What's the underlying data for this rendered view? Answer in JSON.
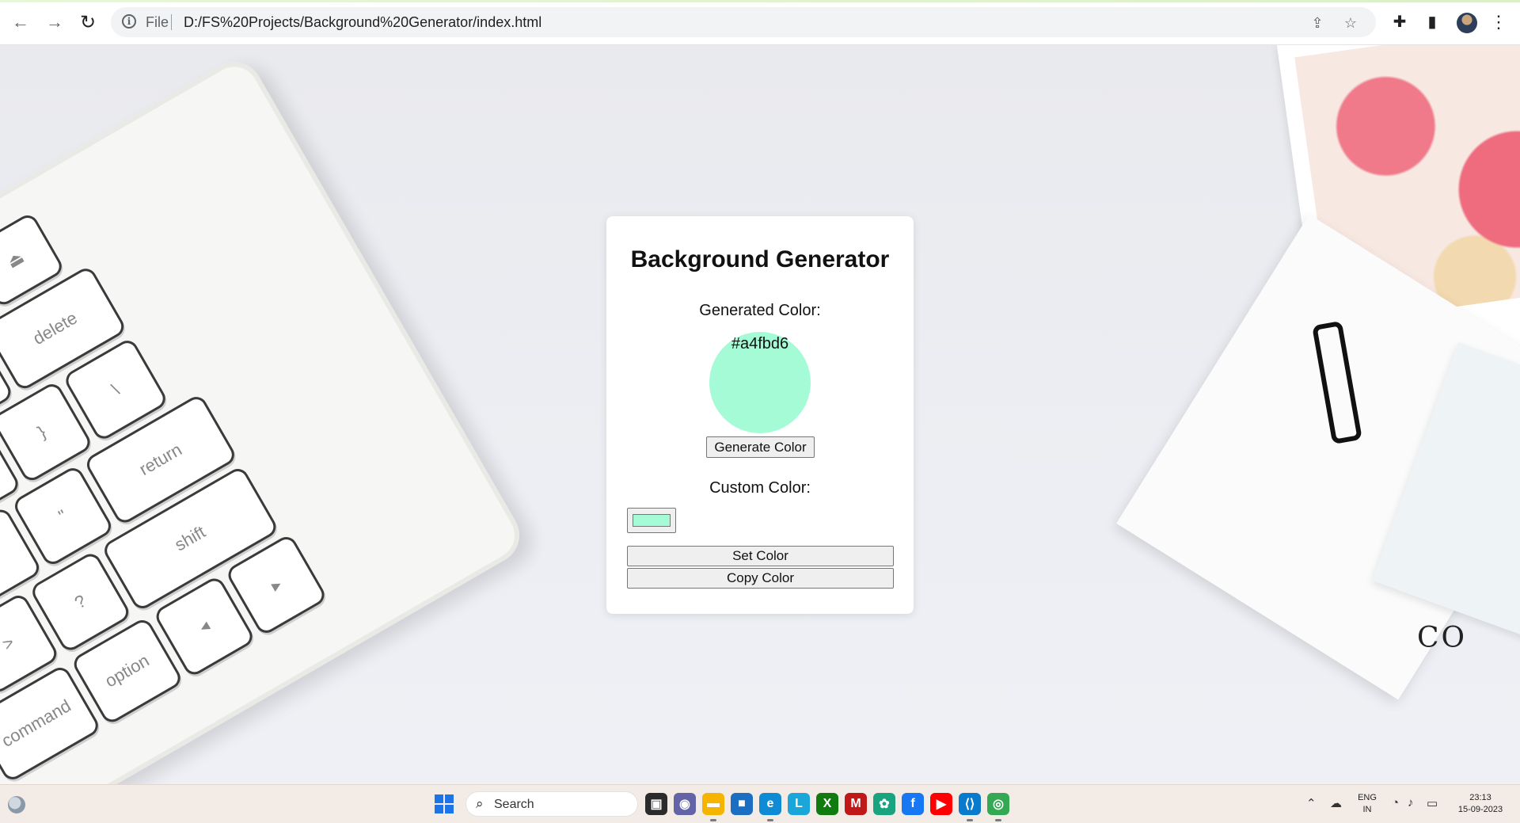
{
  "browser": {
    "nav": {
      "back_icon": "back-arrow-icon",
      "forward_icon": "forward-arrow-icon",
      "reload_icon": "reload-icon"
    },
    "omnibox": {
      "scheme_label": "File",
      "url": "D:/FS%20Projects/Background%20Generator/index.html"
    }
  },
  "app": {
    "title": "Background Generator",
    "generated_label": "Generated Color:",
    "generated_hex": "#a4fbd6",
    "generated_color": "#a4fbd6",
    "generate_button": "Generate Color",
    "custom_label": "Custom Color:",
    "custom_color": "#a4fbd6",
    "set_button": "Set Color",
    "copy_button": "Copy Color"
  },
  "taskbar": {
    "search_placeholder": "Search",
    "apps": [
      {
        "name": "task-view",
        "color": "#2b2b2b",
        "glyph": "▣"
      },
      {
        "name": "teams-chat",
        "color": "#6264a7",
        "glyph": "◉"
      },
      {
        "name": "file-explorer",
        "color": "#f4b400",
        "glyph": "▬"
      },
      {
        "name": "microsoft-store",
        "color": "#1b6ec2",
        "glyph": "■"
      },
      {
        "name": "edge",
        "color": "#0f8bd6",
        "glyph": "e"
      },
      {
        "name": "l-app",
        "color": "#1aa6d9",
        "glyph": "L"
      },
      {
        "name": "xbox",
        "color": "#107c10",
        "glyph": "X"
      },
      {
        "name": "mcafee",
        "color": "#c01818",
        "glyph": "M"
      },
      {
        "name": "chatgpt",
        "color": "#19a37f",
        "glyph": "✿"
      },
      {
        "name": "facebook",
        "color": "#1877f2",
        "glyph": "f"
      },
      {
        "name": "youtube",
        "color": "#ff0000",
        "glyph": "▶"
      },
      {
        "name": "vscode",
        "color": "#0a7acc",
        "glyph": "⟨⟩"
      },
      {
        "name": "chrome",
        "color": "#34a853",
        "glyph": "◎"
      }
    ],
    "tray": {
      "language_line1": "ENG",
      "language_line2": "IN",
      "time": "23:13",
      "date": "15-09-2023"
    }
  }
}
